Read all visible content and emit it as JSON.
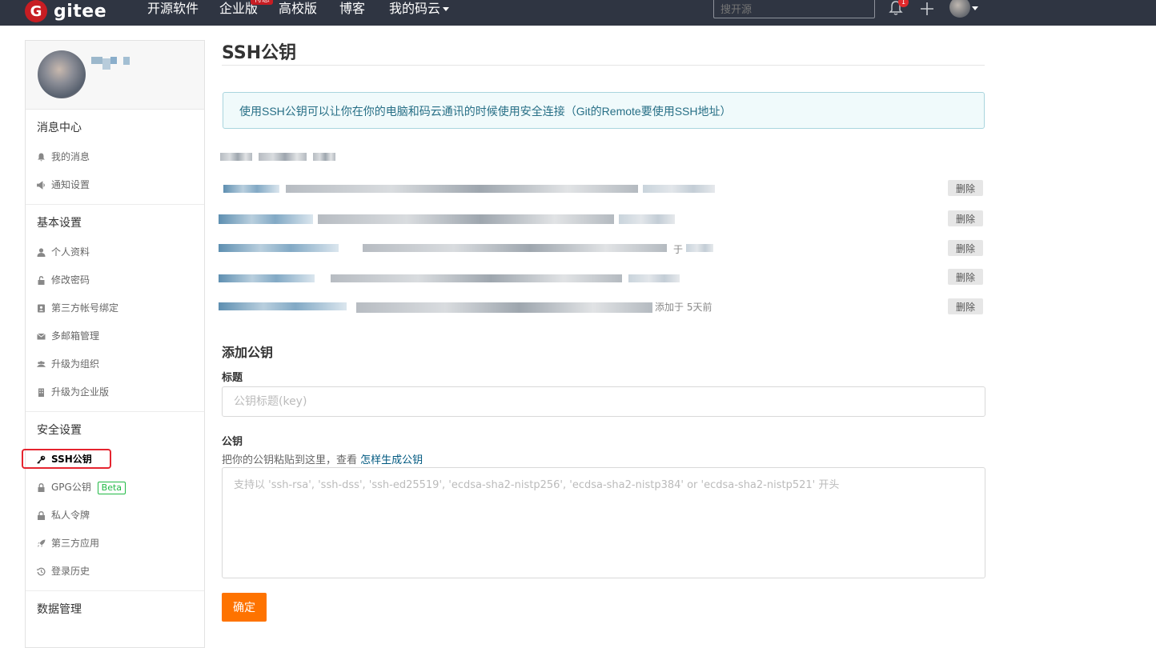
{
  "topnav": {
    "logo_letter": "G",
    "logo_text": "gitee",
    "items": [
      "开源软件",
      "企业版",
      "高校版",
      "博客",
      "我的码云"
    ],
    "badge": "特惠",
    "search_placeholder": "搜开源",
    "notification_count": "1"
  },
  "sidebar": {
    "sections": [
      {
        "title": "消息中心",
        "items": [
          "我的消息",
          "通知设置"
        ]
      },
      {
        "title": "基本设置",
        "items": [
          "个人资料",
          "修改密码",
          "第三方帐号绑定",
          "多邮箱管理",
          "升级为组织",
          "升级为企业版"
        ]
      },
      {
        "title": "安全设置",
        "items": [
          "SSH公钥",
          "GPG公钥",
          "私人令牌",
          "第三方应用",
          "登录历史"
        ]
      },
      {
        "title": "数据管理",
        "items": []
      }
    ],
    "beta_label": "Beta"
  },
  "main": {
    "title": "SSH公钥",
    "info": "使用SSH公钥可以让你在你的电脑和码云通讯的时候使用安全连接（Git的Remote要使用SSH地址）",
    "keys": [
      {
        "tail": "",
        "delete_label": "删除"
      },
      {
        "tail": "",
        "delete_label": "删除"
      },
      {
        "tail": "于",
        "delete_label": "删除"
      },
      {
        "tail": "",
        "delete_label": "删除"
      },
      {
        "tail": "添加于 5天前",
        "delete_label": "删除"
      }
    ],
    "add_title": "添加公钥",
    "label_title": "标题",
    "title_placeholder": "公钥标题(key)",
    "label_key": "公钥",
    "help_text": "把你的公钥粘贴到这里，查看",
    "help_link": "怎样生成公钥",
    "key_placeholder": "支持以 'ssh-rsa', 'ssh-dss', 'ssh-ed25519', 'ecdsa-sha2-nistp256', 'ecdsa-sha2-nistp384' or 'ecdsa-sha2-nistp521' 开头",
    "submit_label": "确定"
  }
}
